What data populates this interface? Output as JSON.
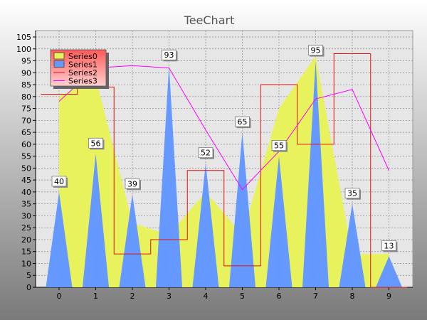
{
  "chart_data": {
    "type": "area",
    "title": "TeeChart",
    "xlabel": "",
    "ylabel": "",
    "xlim": [
      0,
      9
    ],
    "ylim": [
      0,
      105
    ],
    "y_ticks": [
      0,
      5,
      10,
      15,
      20,
      25,
      30,
      35,
      40,
      45,
      50,
      55,
      60,
      65,
      70,
      75,
      80,
      85,
      90,
      95,
      100,
      105
    ],
    "x_ticks": [
      0,
      1,
      2,
      3,
      4,
      5,
      6,
      7,
      8,
      9
    ],
    "grid": true,
    "legend_position": "top-left",
    "series": [
      {
        "name": "Series0",
        "kind": "area",
        "color": "#e8f25c",
        "x": [
          0,
          1,
          2,
          3,
          4,
          5,
          6,
          7,
          8,
          9
        ],
        "values": [
          80,
          88,
          27,
          22,
          40,
          22,
          75,
          97,
          14,
          14
        ]
      },
      {
        "name": "Series1",
        "kind": "spike-area",
        "color": "#6699ff",
        "x": [
          0,
          1,
          2,
          3,
          4,
          5,
          6,
          7,
          8,
          9
        ],
        "values": [
          40,
          56,
          39,
          93,
          52,
          65,
          55,
          95,
          35,
          13
        ],
        "marks": true
      },
      {
        "name": "Series2",
        "kind": "step",
        "color": "#e01010",
        "x": [
          0,
          1,
          2,
          3,
          4,
          5,
          6,
          7,
          8,
          9
        ],
        "values": [
          81,
          84,
          14,
          20,
          49,
          9,
          85,
          60,
          98,
          0
        ]
      },
      {
        "name": "Series3",
        "kind": "line",
        "color": "#ff00ff",
        "x": [
          0,
          1,
          2,
          3,
          4,
          5,
          6,
          7,
          8,
          9
        ],
        "values": [
          78,
          92,
          93,
          92,
          66,
          41,
          57,
          79,
          83,
          49
        ]
      }
    ]
  }
}
